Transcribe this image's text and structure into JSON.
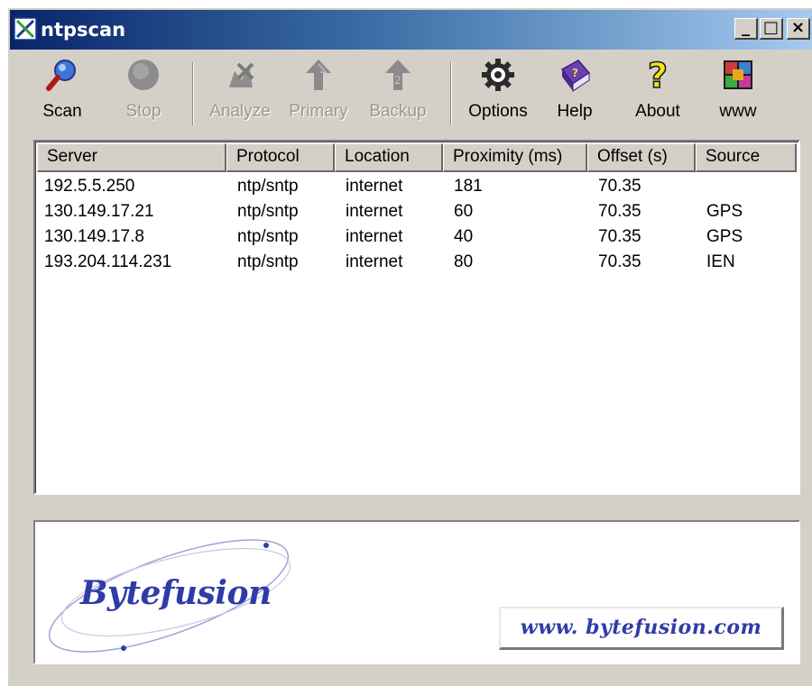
{
  "window": {
    "title": "ntpscan",
    "caption_buttons": {
      "minimize": "_",
      "maximize": "□",
      "close": "×"
    }
  },
  "toolbar": {
    "buttons": [
      {
        "label": "Scan",
        "icon": "magnifier-icon",
        "enabled": true
      },
      {
        "label": "Stop",
        "icon": "stop-icon",
        "enabled": false
      },
      {
        "label": "Analyze",
        "icon": "analyze-icon",
        "enabled": false
      },
      {
        "label": "Primary",
        "icon": "primary-arrow-icon",
        "enabled": false
      },
      {
        "label": "Backup",
        "icon": "backup-arrow-icon",
        "enabled": false
      },
      {
        "label": "Options",
        "icon": "gear-icon",
        "enabled": true
      },
      {
        "label": "Help",
        "icon": "help-book-icon",
        "enabled": true
      },
      {
        "label": "About",
        "icon": "question-mark-icon",
        "enabled": true
      },
      {
        "label": "www",
        "icon": "web-tiles-icon",
        "enabled": true
      }
    ]
  },
  "server_list": {
    "columns": [
      "Server",
      "Protocol",
      "Location",
      "Proximity (ms)",
      "Offset (s)",
      "Source"
    ],
    "rows": [
      [
        "192.5.5.250",
        "ntp/sntp",
        "internet",
        "181",
        "70.35",
        ""
      ],
      [
        "130.149.17.21",
        "ntp/sntp",
        "internet",
        "60",
        "70.35",
        "GPS"
      ],
      [
        "130.149.17.8",
        "ntp/sntp",
        "internet",
        "40",
        "70.35",
        "GPS"
      ],
      [
        "193.204.114.231",
        "ntp/sntp",
        "internet",
        "80",
        "70.35",
        "IEN"
      ]
    ]
  },
  "branding": {
    "logo_text": "Bytefusion",
    "url": "www. bytefusion.com"
  },
  "colors": {
    "titlebar_start": "#0a246a",
    "titlebar_end": "#a6caf0",
    "face": "#d4d0c8",
    "brand_blue": "#2f3ca8"
  }
}
